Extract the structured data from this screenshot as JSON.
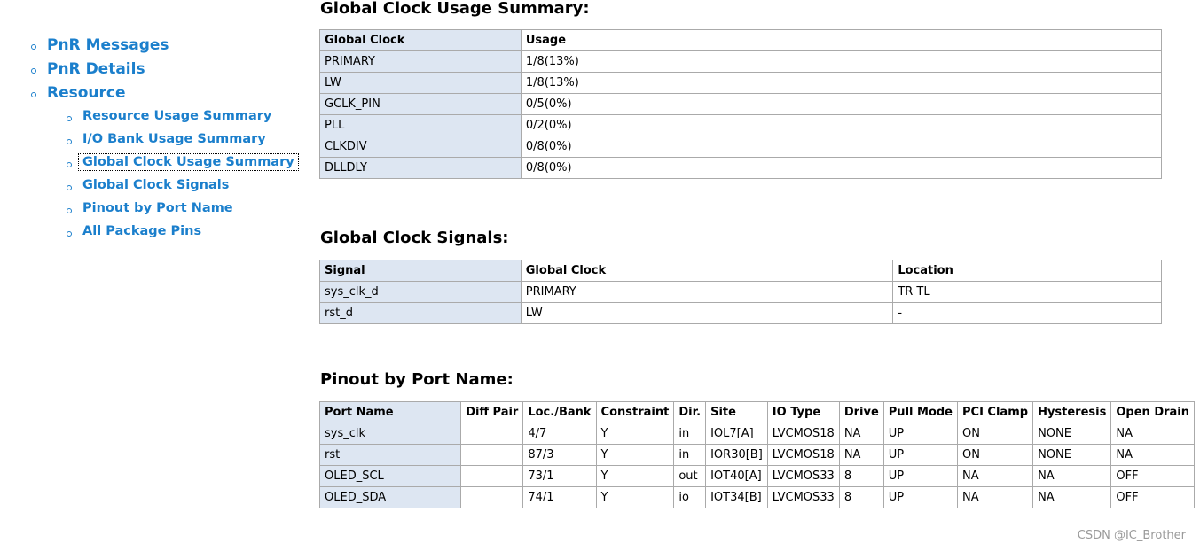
{
  "nav": {
    "top": [
      {
        "label": "PnR Messages"
      },
      {
        "label": "PnR Details"
      },
      {
        "label": "Resource"
      }
    ],
    "sub": [
      {
        "label": "Resource Usage Summary"
      },
      {
        "label": "I/O Bank Usage Summary"
      },
      {
        "label": "Global Clock Usage Summary"
      },
      {
        "label": "Global Clock Signals"
      },
      {
        "label": "Pinout by Port Name"
      },
      {
        "label": "All Package Pins"
      }
    ]
  },
  "clock_usage": {
    "title": "Global Clock Usage Summary:",
    "headers": [
      "Global Clock",
      "Usage"
    ],
    "rows": [
      [
        "PRIMARY",
        "1/8(13%)"
      ],
      [
        "LW",
        "1/8(13%)"
      ],
      [
        "GCLK_PIN",
        "0/5(0%)"
      ],
      [
        "PLL",
        "0/2(0%)"
      ],
      [
        "CLKDIV",
        "0/8(0%)"
      ],
      [
        "DLLDLY",
        "0/8(0%)"
      ]
    ]
  },
  "clock_signals": {
    "title": "Global Clock Signals:",
    "headers": [
      "Signal",
      "Global Clock",
      "Location"
    ],
    "rows": [
      [
        "sys_clk_d",
        "PRIMARY",
        "TR TL"
      ],
      [
        "rst_d",
        "LW",
        "-"
      ]
    ]
  },
  "pinout": {
    "title": "Pinout by Port Name:",
    "headers": [
      "Port Name",
      "Diff Pair",
      "Loc./Bank",
      "Constraint",
      "Dir.",
      "Site",
      "IO Type",
      "Drive",
      "Pull Mode",
      "PCI Clamp",
      "Hysteresis",
      "Open Drain"
    ],
    "rows": [
      [
        "sys_clk",
        "",
        "4/7",
        "Y",
        "in",
        "IOL7[A]",
        "LVCMOS18",
        "NA",
        "UP",
        "ON",
        "NONE",
        "NA"
      ],
      [
        "rst",
        "",
        "87/3",
        "Y",
        "in",
        "IOR30[B]",
        "LVCMOS18",
        "NA",
        "UP",
        "ON",
        "NONE",
        "NA"
      ],
      [
        "OLED_SCL",
        "",
        "73/1",
        "Y",
        "out",
        "IOT40[A]",
        "LVCMOS33",
        "8",
        "UP",
        "NA",
        "NA",
        "OFF"
      ],
      [
        "OLED_SDA",
        "",
        "74/1",
        "Y",
        "io",
        "IOT34[B]",
        "LVCMOS33",
        "8",
        "UP",
        "NA",
        "NA",
        "OFF"
      ]
    ]
  },
  "watermark": "CSDN @IC_Brother",
  "colors": {
    "link": "#1b7fcc",
    "first_column_bg": "#dde6f2",
    "border": "#aaaaaa"
  }
}
